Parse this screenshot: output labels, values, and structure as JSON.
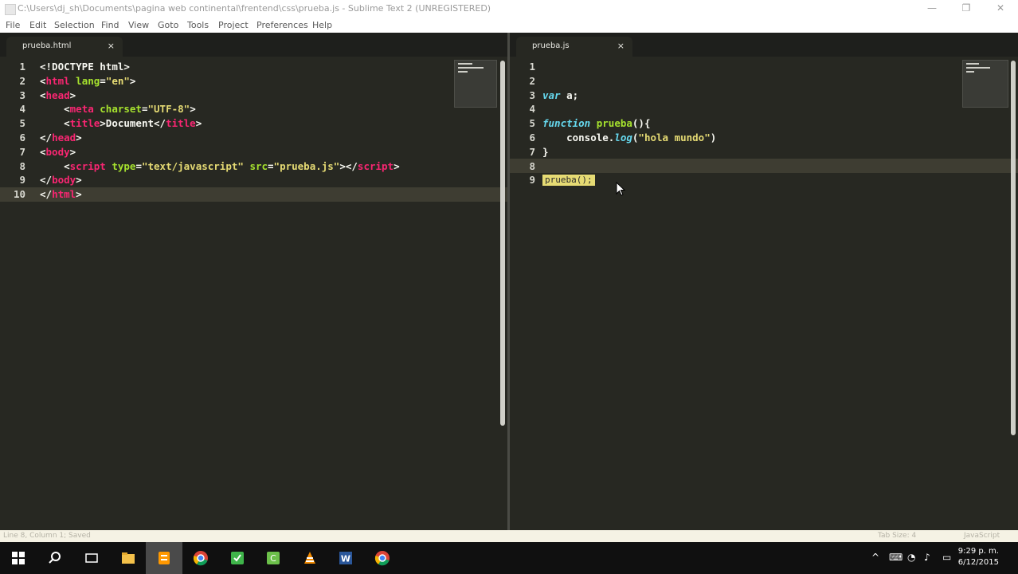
{
  "window": {
    "title": "C:\\Users\\dj_sh\\Documents\\pagina web continental\\frentend\\css\\prueba.js - Sublime Text 2 (UNREGISTERED)",
    "controls": {
      "minimize": "—",
      "maximize": "❐",
      "close": "✕"
    }
  },
  "menu": [
    "File",
    "Edit",
    "Selection",
    "Find",
    "View",
    "Goto",
    "Tools",
    "Project",
    "Preferences",
    "Help"
  ],
  "left_pane": {
    "tab_label": "prueba.html",
    "tab_close": "×",
    "line_numbers": [
      "1",
      "2",
      "3",
      "4",
      "5",
      "6",
      "7",
      "8",
      "9",
      "10"
    ],
    "lines": [
      [
        {
          "t": "<",
          "c": "plain"
        },
        {
          "t": "!DOCTYPE html",
          "c": "plain"
        },
        {
          "t": ">",
          "c": "plain"
        }
      ],
      [
        {
          "t": "<",
          "c": "plain"
        },
        {
          "t": "html",
          "c": "tag"
        },
        {
          "t": " ",
          "c": "plain"
        },
        {
          "t": "lang",
          "c": "attr"
        },
        {
          "t": "=",
          "c": "plain"
        },
        {
          "t": "\"en\"",
          "c": "str"
        },
        {
          "t": ">",
          "c": "plain"
        }
      ],
      [
        {
          "t": "<",
          "c": "plain"
        },
        {
          "t": "head",
          "c": "tag"
        },
        {
          "t": ">",
          "c": "plain"
        }
      ],
      [
        {
          "t": "    <",
          "c": "plain"
        },
        {
          "t": "meta",
          "c": "tag"
        },
        {
          "t": " ",
          "c": "plain"
        },
        {
          "t": "charset",
          "c": "attr"
        },
        {
          "t": "=",
          "c": "plain"
        },
        {
          "t": "\"UTF-8\"",
          "c": "str"
        },
        {
          "t": ">",
          "c": "plain"
        }
      ],
      [
        {
          "t": "    <",
          "c": "plain"
        },
        {
          "t": "title",
          "c": "tag"
        },
        {
          "t": ">Document</",
          "c": "plain"
        },
        {
          "t": "title",
          "c": "tag"
        },
        {
          "t": ">",
          "c": "plain"
        }
      ],
      [
        {
          "t": "</",
          "c": "plain"
        },
        {
          "t": "head",
          "c": "tag"
        },
        {
          "t": ">",
          "c": "plain"
        }
      ],
      [
        {
          "t": "<",
          "c": "plain"
        },
        {
          "t": "body",
          "c": "tag"
        },
        {
          "t": ">",
          "c": "plain"
        }
      ],
      [
        {
          "t": "    <",
          "c": "plain"
        },
        {
          "t": "script",
          "c": "tag"
        },
        {
          "t": " ",
          "c": "plain"
        },
        {
          "t": "type",
          "c": "attr"
        },
        {
          "t": "=",
          "c": "plain"
        },
        {
          "t": "\"text/javascript\"",
          "c": "str"
        },
        {
          "t": " ",
          "c": "plain"
        },
        {
          "t": "src",
          "c": "attr"
        },
        {
          "t": "=",
          "c": "plain"
        },
        {
          "t": "\"prueba.js\"",
          "c": "str"
        },
        {
          "t": "></",
          "c": "plain"
        },
        {
          "t": "script",
          "c": "tag"
        },
        {
          "t": ">",
          "c": "plain"
        }
      ],
      [
        {
          "t": "</",
          "c": "plain"
        },
        {
          "t": "body",
          "c": "tag"
        },
        {
          "t": ">",
          "c": "plain"
        }
      ],
      [
        {
          "t": "</",
          "c": "plain"
        },
        {
          "t": "html",
          "c": "tag"
        },
        {
          "t": ">",
          "c": "plain"
        }
      ]
    ]
  },
  "right_pane": {
    "tab_label": "prueba.js",
    "tab_close": "×",
    "line_numbers": [
      "1",
      "2",
      "3",
      "4",
      "5",
      "6",
      "7",
      "8",
      "9"
    ],
    "lines": [
      [],
      [],
      [
        {
          "t": "var",
          "c": "kw"
        },
        {
          "t": " a;",
          "c": "plain"
        }
      ],
      [],
      [
        {
          "t": "function",
          "c": "kw"
        },
        {
          "t": " ",
          "c": "plain"
        },
        {
          "t": "prueba",
          "c": "fn"
        },
        {
          "t": "(){",
          "c": "plain"
        }
      ],
      [
        {
          "t": "    console.",
          "c": "plain"
        },
        {
          "t": "log",
          "c": "kw"
        },
        {
          "t": "(",
          "c": "plain"
        },
        {
          "t": "\"hola mundo\"",
          "c": "str"
        },
        {
          "t": ")",
          "c": "plain"
        }
      ],
      [
        {
          "t": "}",
          "c": "plain"
        }
      ],
      [],
      []
    ],
    "autocomplete_text": "prueba();"
  },
  "statusbar": {
    "left": "Line 8, Column 1; Saved",
    "right_left": "Tab Size: 4",
    "right": "JavaScript"
  },
  "taskbar": {
    "apps": [
      "windows-start",
      "search",
      "task-view",
      "file-explorer",
      "sublime-text",
      "chrome",
      "camtasia",
      "camtasia-recorder",
      "vlc",
      "word",
      "chrome-2"
    ],
    "clock_time": "9:29 p. m.",
    "clock_date": "6/12/2015"
  }
}
